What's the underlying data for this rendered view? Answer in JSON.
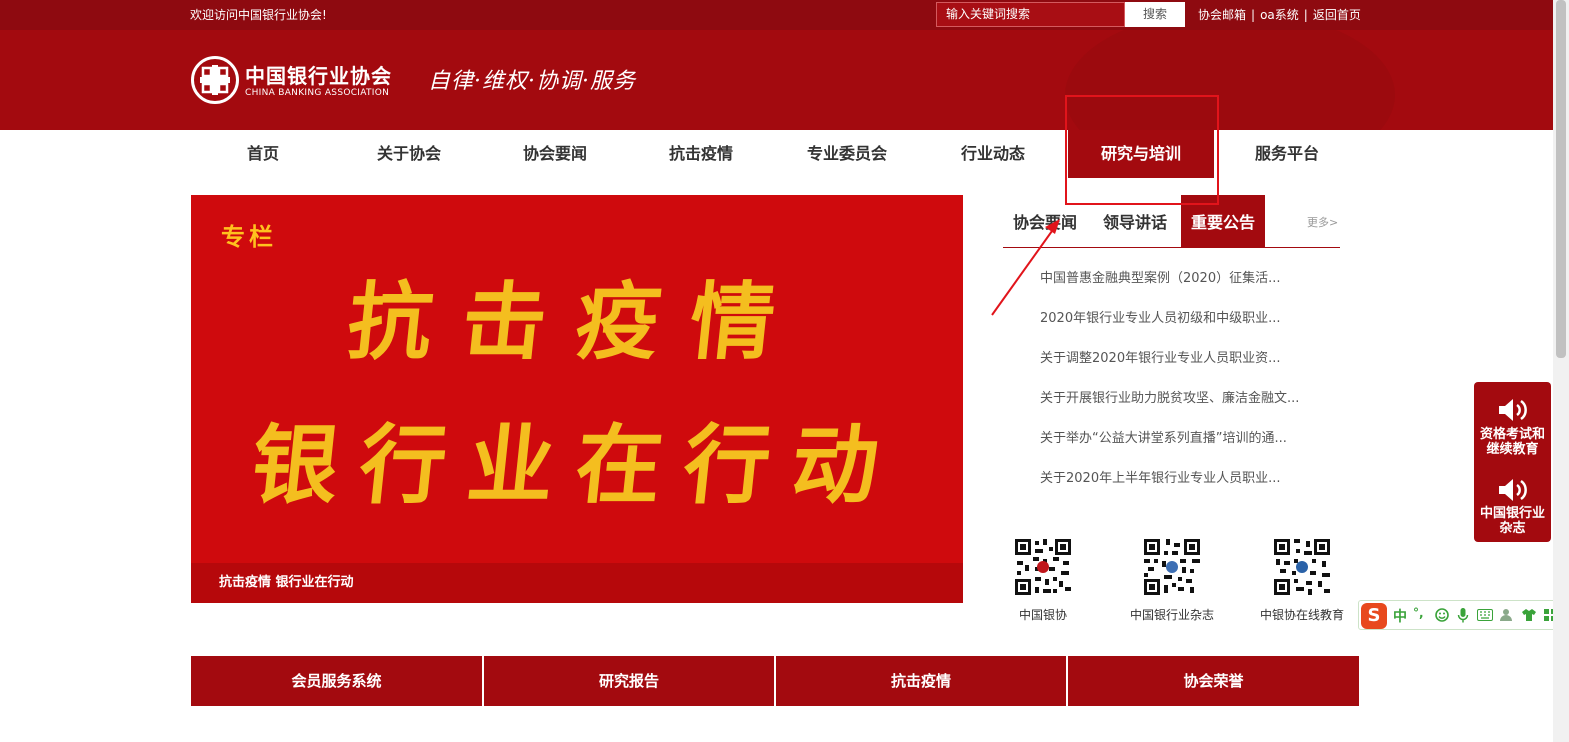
{
  "topbar": {
    "welcome": "欢迎访问中国银行业协会!",
    "search_placeholder": "输入关键词搜索",
    "search_button": "搜索",
    "links": [
      "协会邮箱",
      "oa系统",
      "返回首页"
    ],
    "separator": "|"
  },
  "header": {
    "logo_cn": "中国银行业协会",
    "logo_en": "CHINA BANKING ASSOCIATION",
    "slogan": "自律·维权·协调·服务"
  },
  "nav": {
    "items": [
      {
        "label": "首页"
      },
      {
        "label": "关于协会"
      },
      {
        "label": "协会要闻"
      },
      {
        "label": "抗击疫情"
      },
      {
        "label": "专业委员会"
      },
      {
        "label": "行业动态"
      },
      {
        "label": "研究与培训",
        "active": true
      },
      {
        "label": "服务平台"
      }
    ]
  },
  "banner": {
    "tag": "专栏",
    "line1": "抗击疫情",
    "line2": "银行业在行动",
    "caption": "抗击疫情 银行业在行动"
  },
  "news_panel": {
    "tabs": [
      {
        "label": "协会要闻"
      },
      {
        "label": "领导讲话"
      },
      {
        "label": "重要公告",
        "active": true
      }
    ],
    "more": "更多>",
    "items": [
      "中国普惠金融典型案例（2020）征集活...",
      "2020年银行业专业人员初级和中级职业...",
      "关于调整2020年银行业专业人员职业资...",
      "关于开展银行业助力脱贫攻坚、廉洁金融文...",
      "关于举办“公益大讲堂系列直播”培训的通...",
      "关于2020年上半年银行业专业人员职业..."
    ]
  },
  "qrcodes": [
    {
      "label": "中国银协"
    },
    {
      "label": "中国银行业杂志"
    },
    {
      "label": "中银协在线教育"
    }
  ],
  "bottom_links": [
    "会员服务系统",
    "研究报告",
    "抗击疫情",
    "协会荣誉"
  ],
  "float_panel": {
    "items": [
      {
        "label_l1": "资格考试和",
        "label_l2": "继续教育",
        "icon": "speaker-icon"
      },
      {
        "label_l1": "中国银行业",
        "label_l2": "杂志",
        "icon": "speaker-icon"
      }
    ]
  },
  "ime_bar": {
    "logo": "S",
    "mode": "中",
    "punct": "°,"
  },
  "colors": {
    "brand": "#a30a0f",
    "topbar": "#8e0a10",
    "banner": "#cf0a0d",
    "banner_text": "#f4be1f",
    "annotation": "#e1141b"
  }
}
